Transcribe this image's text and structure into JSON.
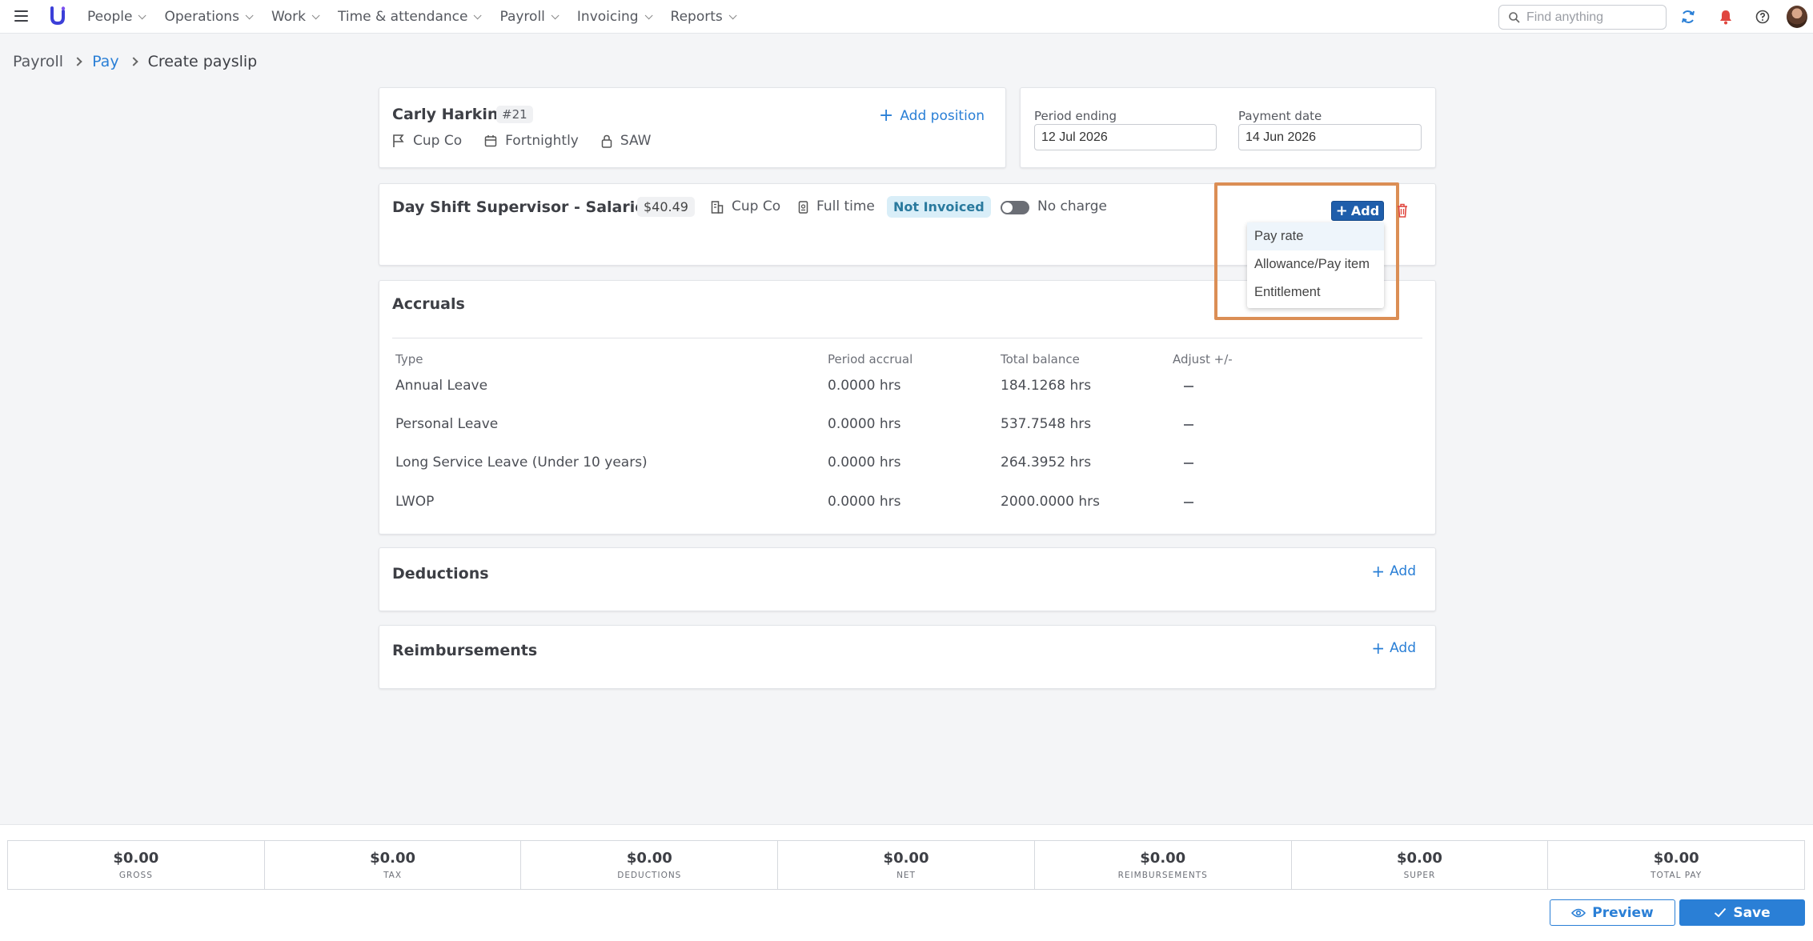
{
  "nav": {
    "items": [
      {
        "label": "People"
      },
      {
        "label": "Operations"
      },
      {
        "label": "Work"
      },
      {
        "label": "Time & attendance"
      },
      {
        "label": "Payroll"
      },
      {
        "label": "Invoicing"
      },
      {
        "label": "Reports"
      }
    ],
    "search_placeholder": "Find anything"
  },
  "breadcrumb": {
    "items": [
      "Payroll",
      "Pay",
      "Create payslip"
    ]
  },
  "employee": {
    "name": "Carly Harkin",
    "id": "#21",
    "company": "Cup Co",
    "frequency": "Fortnightly",
    "award": "SAW",
    "add_position_label": "Add position"
  },
  "dates": {
    "period_ending_label": "Period ending",
    "period_ending_value": "12 Jul 2026",
    "payment_date_label": "Payment date",
    "payment_date_value": "14 Jun 2026"
  },
  "position": {
    "title": "Day Shift Supervisor - Salaried",
    "rate": "$40.49",
    "company": "Cup Co",
    "employment": "Full time",
    "status": "Not Invoiced",
    "charge_label": "No charge",
    "add_label": "Add",
    "dropdown": [
      "Pay rate",
      "Allowance/Pay item",
      "Entitlement"
    ]
  },
  "accruals": {
    "title": "Accruals",
    "headers": [
      "Type",
      "Period accrual",
      "Total balance",
      "Adjust +/-"
    ],
    "rows": [
      {
        "type": "Annual Leave",
        "period": "0.0000 hrs",
        "balance": "184.1268 hrs"
      },
      {
        "type": "Personal Leave",
        "period": "0.0000 hrs",
        "balance": "537.7548 hrs"
      },
      {
        "type": "Long Service Leave (Under 10 years)",
        "period": "0.0000 hrs",
        "balance": "264.3952 hrs"
      },
      {
        "type": "LWOP",
        "period": "0.0000 hrs",
        "balance": "2000.0000 hrs"
      }
    ]
  },
  "deductions": {
    "title": "Deductions",
    "add_label": "Add"
  },
  "reimbursements": {
    "title": "Reimbursements",
    "add_label": "Add"
  },
  "totals": [
    {
      "amount": "$0.00",
      "label": "GROSS"
    },
    {
      "amount": "$0.00",
      "label": "TAX"
    },
    {
      "amount": "$0.00",
      "label": "DEDUCTIONS"
    },
    {
      "amount": "$0.00",
      "label": "NET"
    },
    {
      "amount": "$0.00",
      "label": "REIMBURSEMENTS"
    },
    {
      "amount": "$0.00",
      "label": "SUPER"
    },
    {
      "amount": "$0.00",
      "label": "TOTAL PAY"
    }
  ],
  "actions": {
    "preview_label": "Preview",
    "save_label": "Save"
  },
  "colors": {
    "accent": "#2a7fd6",
    "primary_button": "#1f5eab",
    "highlight": "#db8e55",
    "status_pill": "#d9eef8",
    "alert": "#e0463f"
  }
}
